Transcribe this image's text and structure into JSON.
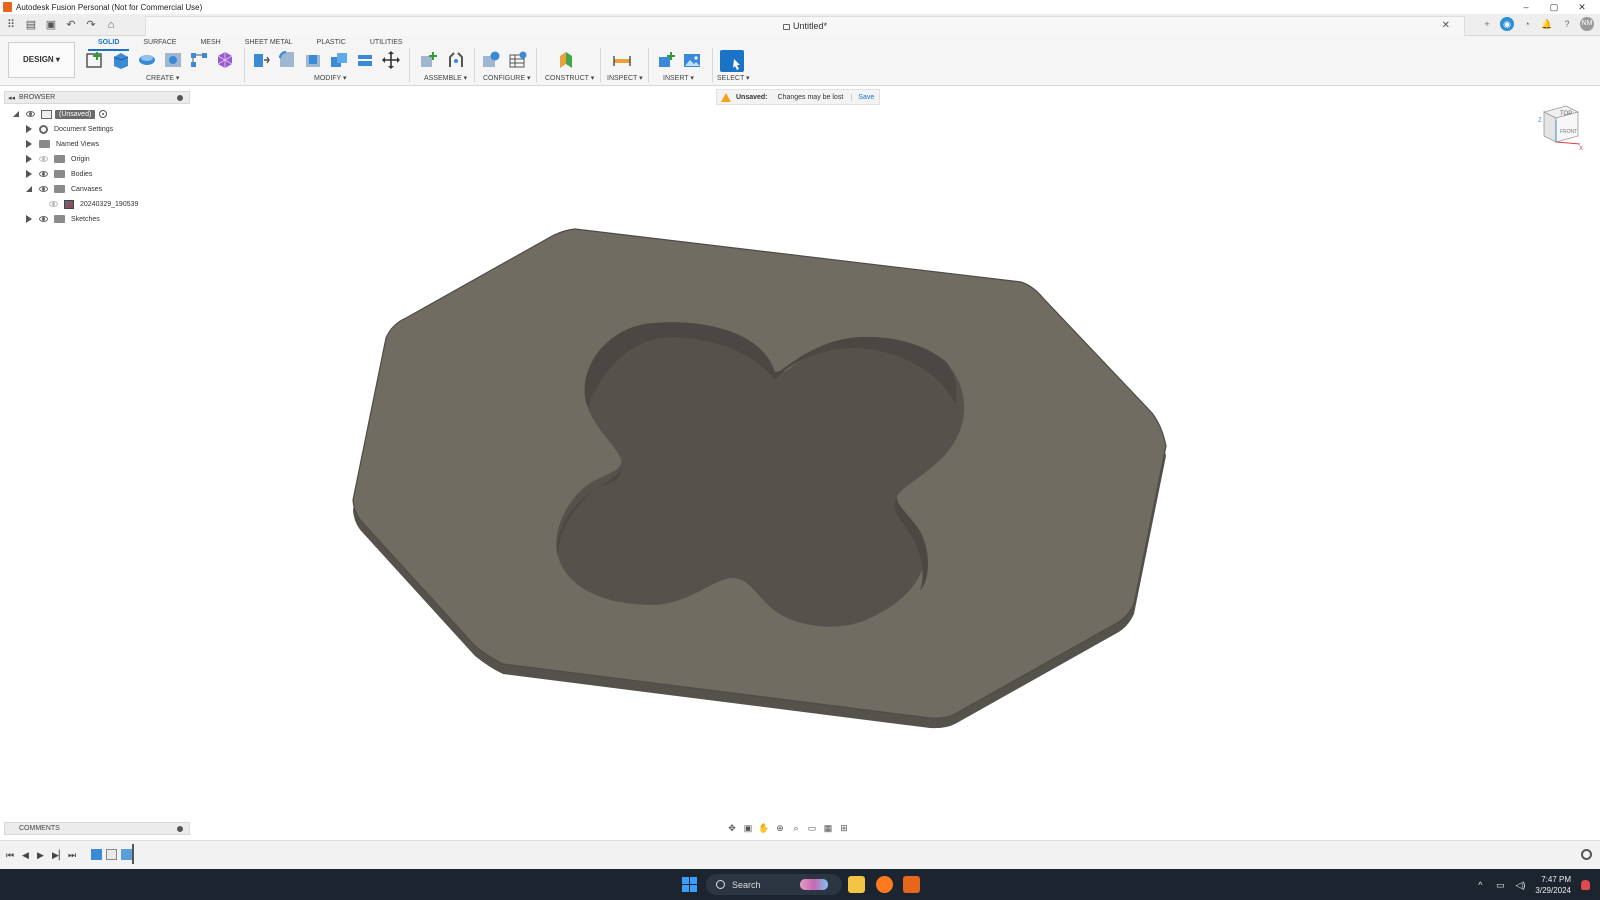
{
  "window": {
    "title": "Autodesk Fusion Personal (Not for Commercial Use)",
    "controls": [
      "–",
      "▢",
      "✕"
    ]
  },
  "document": {
    "tab_title": "Untitled*",
    "close_glyph": "✕"
  },
  "user": {
    "initials": "NM"
  },
  "toolbar": {
    "workspace": "DESIGN ▾",
    "tabs": [
      "SOLID",
      "SURFACE",
      "MESH",
      "SHEET METAL",
      "PLASTIC",
      "UTILITIES"
    ],
    "active_tab": "SOLID",
    "groups": [
      "CREATE ▾",
      "MODIFY ▾",
      "ASSEMBLE ▾",
      "CONFIGURE ▾",
      "CONSTRUCT ▾",
      "INSPECT ▾",
      "INSERT ▾",
      "SELECT ▾"
    ]
  },
  "message": {
    "label": "Unsaved:",
    "text": "Changes may be lost",
    "action": "Save"
  },
  "browser": {
    "title": "BROWSER",
    "root": "(Unsaved)",
    "items": [
      {
        "label": "Document Settings",
        "icon": "gear-icon"
      },
      {
        "label": "Named Views",
        "icon": "folder-icon"
      },
      {
        "label": "Origin",
        "icon": "folder-icon"
      },
      {
        "label": "Bodies",
        "icon": "folder-icon"
      },
      {
        "label": "Canvases",
        "icon": "folder-icon"
      },
      {
        "label": "20240329_190539",
        "icon": "image-icon"
      },
      {
        "label": "Sketches",
        "icon": "folder-icon"
      }
    ]
  },
  "viewcube": {
    "top": "TOP",
    "front": "FRONT",
    "z": "Z",
    "x": "X"
  },
  "comments": {
    "title": "COMMENTS"
  },
  "taskbar": {
    "search_placeholder": "Search",
    "time": "7:47 PM",
    "date": "3/29/2024"
  },
  "colors": {
    "accent": "#1a73c6",
    "part_face": "#706c62",
    "part_edge": "#55524b",
    "taskbar": "#1c2430"
  }
}
